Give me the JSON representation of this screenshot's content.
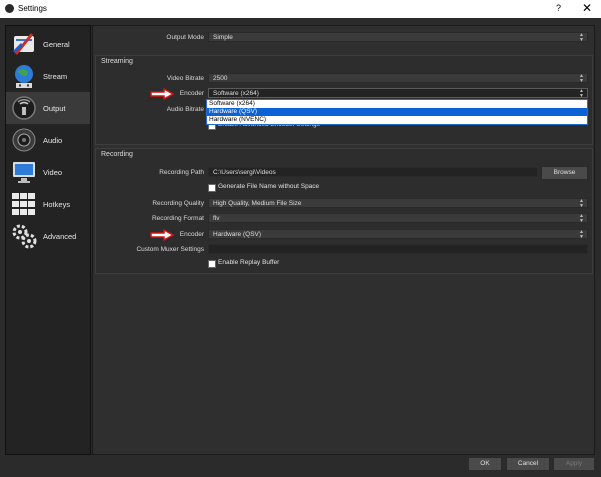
{
  "window": {
    "title": "Settings",
    "help": "?",
    "close": "✕"
  },
  "sidebar": {
    "items": [
      {
        "label": "General",
        "icon": "wrench-screwdriver-icon"
      },
      {
        "label": "Stream",
        "icon": "globe-icon"
      },
      {
        "label": "Output",
        "icon": "output-icon"
      },
      {
        "label": "Audio",
        "icon": "speaker-icon"
      },
      {
        "label": "Video",
        "icon": "monitor-icon"
      },
      {
        "label": "Hotkeys",
        "icon": "keyboard-icon"
      },
      {
        "label": "Advanced",
        "icon": "gears-icon"
      }
    ],
    "active": "Output"
  },
  "output": {
    "mode_label": "Output Mode",
    "mode_value": "Simple"
  },
  "streaming": {
    "title": "Streaming",
    "bitrate_label": "Video Bitrate",
    "bitrate_value": "2500",
    "encoder_label": "Encoder",
    "encoder_value": "Software (x264)",
    "audio_label": "Audio Bitrate",
    "advanced_label": "Enable Advanced Encoder Settings",
    "dropdown_options": [
      "Software (x264)",
      "Hardware (QSV)",
      "Hardware (NVENC)"
    ],
    "dropdown_selected": "Hardware (QSV)"
  },
  "recording": {
    "title": "Recording",
    "path_label": "Recording Path",
    "path_value": "C:\\Users\\sergi\\Videos",
    "browse_label": "Browse",
    "nospace_label": "Generate File Name without Space",
    "quality_label": "Recording Quality",
    "quality_value": "High Quality, Medium File Size",
    "format_label": "Recording Format",
    "format_value": "flv",
    "encoder_label": "Encoder",
    "encoder_value": "Hardware (QSV)",
    "muxer_label": "Custom Muxer Settings",
    "muxer_value": "",
    "replay_label": "Enable Replay Buffer"
  },
  "footer": {
    "ok": "OK",
    "cancel": "Cancel",
    "apply": "Apply"
  },
  "colors": {
    "arrow": "#d81010",
    "selection": "#0b62d6"
  }
}
